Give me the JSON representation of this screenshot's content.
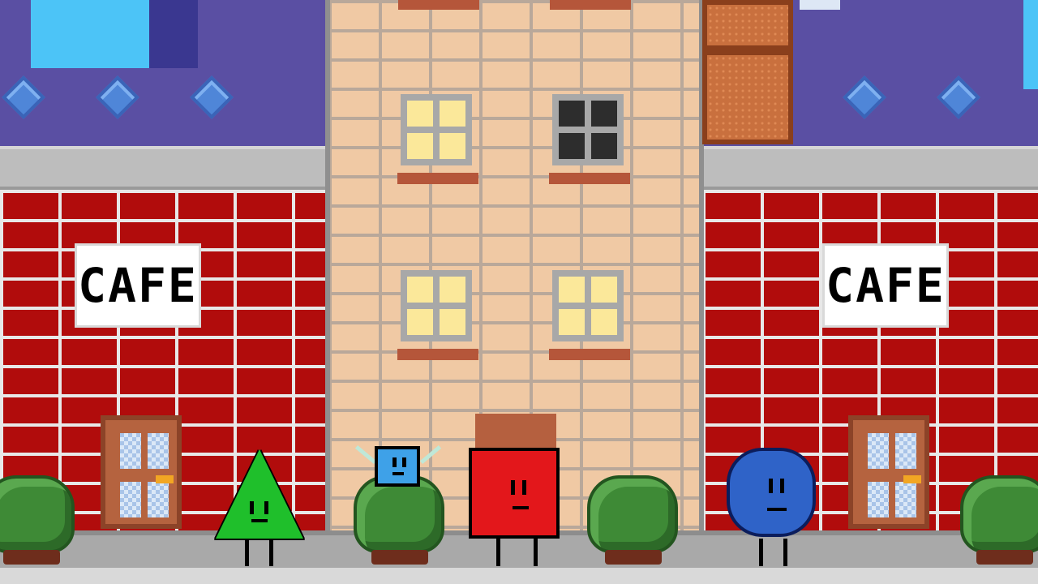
{
  "scene": {
    "left_sign": "CAFE",
    "right_sign": "CAFE"
  },
  "colors": {
    "red_brick": "#b10c0c",
    "tan_brick": "#f0c9a4",
    "roof": "#5a4fa3",
    "lit_window": "#fbe89a",
    "dark_window": "#2d2d2d",
    "sidewalk": "#a9a9a9"
  },
  "characters": [
    {
      "name": "triangle",
      "color": "#1fbf2b"
    },
    {
      "name": "small-box",
      "color": "#3ea1e8"
    },
    {
      "name": "red-box",
      "color": "#e3171b"
    },
    {
      "name": "blue-circle",
      "color": "#2f63c8"
    }
  ]
}
